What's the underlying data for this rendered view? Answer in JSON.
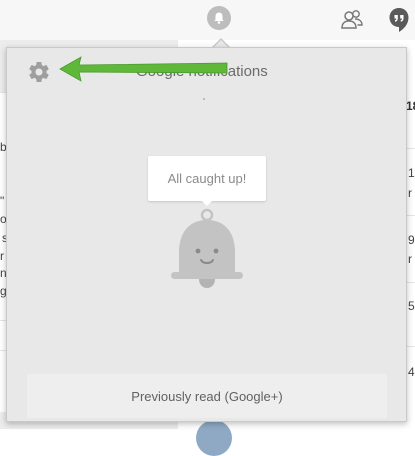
{
  "panel": {
    "title": "Google notifications",
    "empty_message": "All caught up!",
    "previously_read_label": "Previously read (Google+)"
  },
  "background": {
    "left_fragments": [
      "b",
      "\"",
      "o",
      "s",
      "r",
      "n",
      "g",
      "c"
    ],
    "right_fragments": [
      "18",
      "15",
      "r",
      "9",
      "r",
      "5",
      "4"
    ]
  },
  "icons": {
    "settings": "gear-icon",
    "bell": "bell-icon",
    "share": "people-share-icon",
    "hangouts": "hangouts-icon",
    "arrow": "arrow-annotation-icon"
  },
  "colors": {
    "panel_bg": "#e8e8e8",
    "arrow_green": "#5fb83a",
    "gear_gray": "#9e9e9e",
    "bell_gray": "#bdbdbd"
  }
}
